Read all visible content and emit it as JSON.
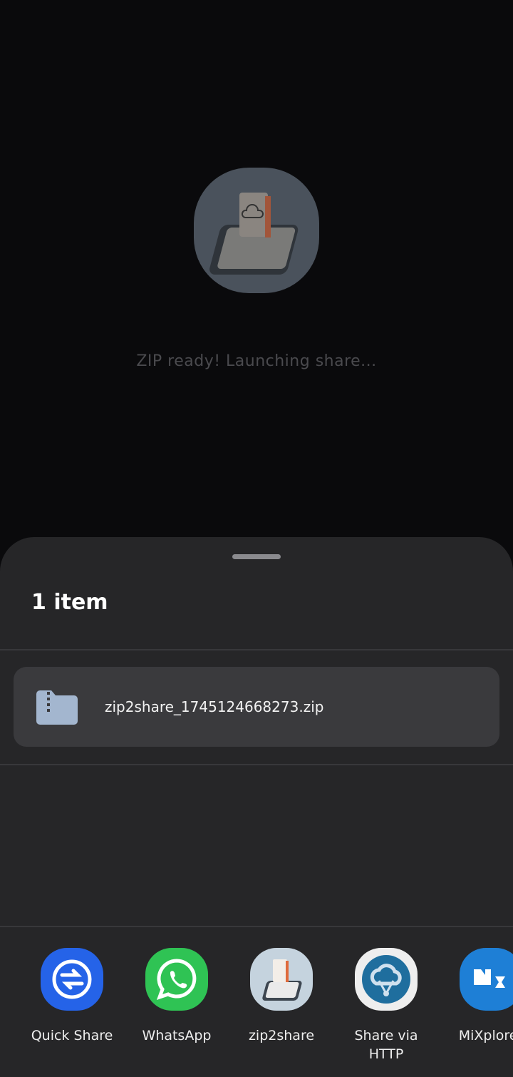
{
  "splash": {
    "status_text": "ZIP ready! Launching share..."
  },
  "sheet": {
    "title": "1 item",
    "file_name": "zip2share_1745124668273.zip"
  },
  "apps": [
    {
      "label": "Quick Share",
      "color": "#2563e8"
    },
    {
      "label": "WhatsApp",
      "color": "#2fc354"
    },
    {
      "label": "zip2share",
      "color": "#c5d3de"
    },
    {
      "label": "Share via HTTP",
      "color": "#eeeeee"
    },
    {
      "label": "MiXplorer",
      "color": "#1e7fd6"
    }
  ]
}
